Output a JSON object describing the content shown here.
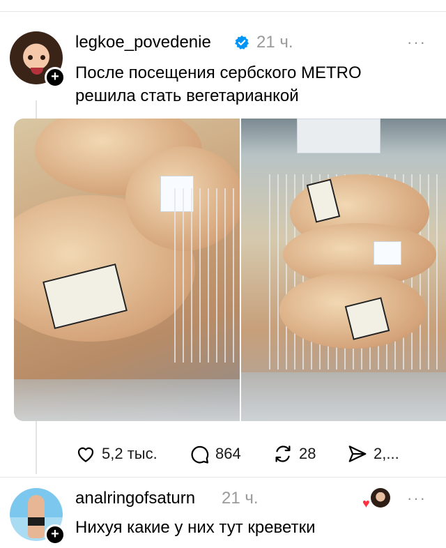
{
  "post": {
    "username": "legkoe_povedenie",
    "time": "21 ч.",
    "more": "···",
    "text_line1": "После посещения сербского METRO",
    "text_line2": "решила стать вегетарианкой",
    "verified_icon": "verified-badge-icon",
    "accent": "#0095f6"
  },
  "actions": {
    "likes": "5,2 тыс.",
    "comments": "864",
    "reposts": "28",
    "shares": "2,..."
  },
  "reply": {
    "username": "analringofsaturn",
    "time": "21 ч.",
    "more": "···",
    "text": "Нихуя какие у них тут креветки",
    "liked_by_author_color": "#ff3040"
  },
  "badges": {
    "follow_plus": "+"
  }
}
